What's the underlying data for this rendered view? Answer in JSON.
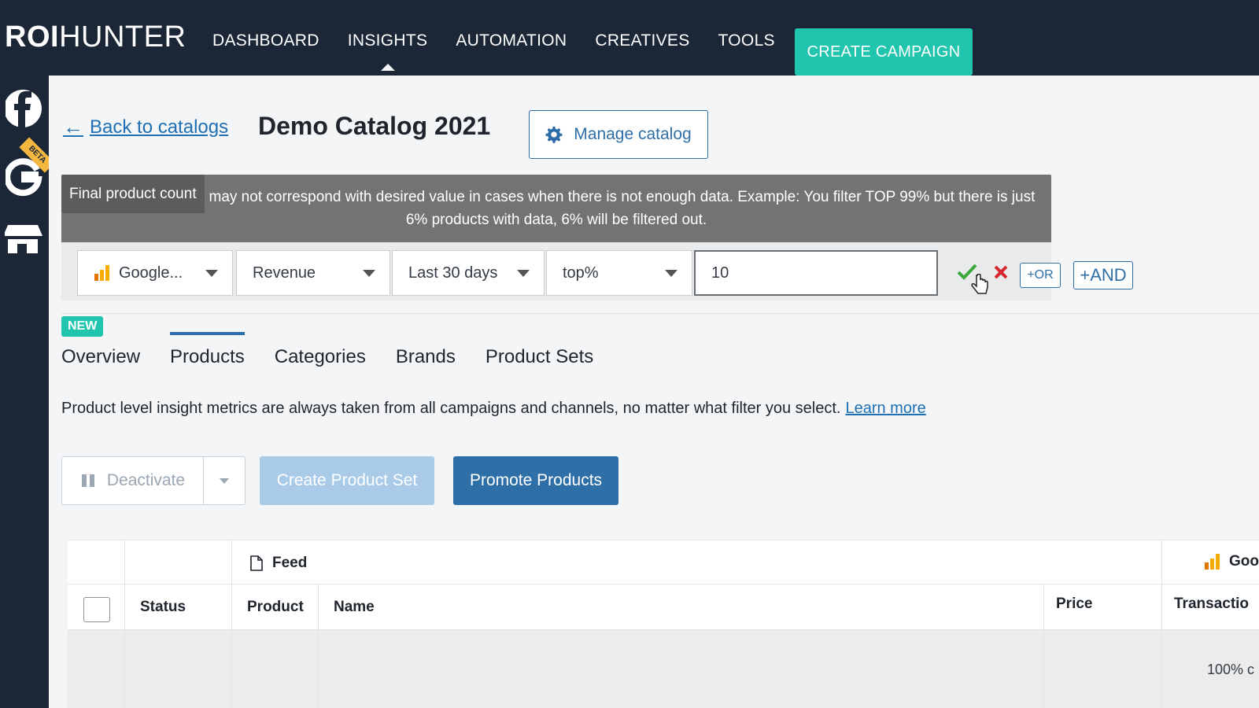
{
  "brand": {
    "logo_bold": "ROI",
    "logo_light": "HUNTER"
  },
  "nav": {
    "items": [
      {
        "label": "DASHBOARD"
      },
      {
        "label": "INSIGHTS",
        "active": true
      },
      {
        "label": "AUTOMATION"
      },
      {
        "label": "CREATIVES"
      },
      {
        "label": "TOOLS"
      }
    ],
    "create_campaign": "CREATE CAMPAIGN"
  },
  "rail": {
    "icons": [
      "facebook-icon",
      "google-icon",
      "shop-icon"
    ],
    "beta": "BETA"
  },
  "header": {
    "back_link": "Back to catalogs",
    "title": "Demo Catalog 2021",
    "manage_button": "Manage catalog"
  },
  "notice": {
    "text": "Final product count may not correspond with desired value in cases when there is not enough data. Example: You filter TOP 99% but there is just 6% products with data, 6% will be filtered out.",
    "tooltip": "Final product count"
  },
  "filter": {
    "source": "Google...",
    "metric": "Revenue",
    "period": "Last 30 days",
    "operator": "top%",
    "value": "10",
    "or_label": "+OR",
    "and_label": "+AND"
  },
  "tabs": {
    "new_badge": "NEW",
    "items": [
      {
        "label": "Overview"
      },
      {
        "label": "Products",
        "active": true
      },
      {
        "label": "Categories"
      },
      {
        "label": "Brands"
      },
      {
        "label": "Product Sets"
      }
    ]
  },
  "info": {
    "text": "Product level insight metrics are always taken from all campaigns and channels, no matter what filter you select.",
    "learn_more": "Learn more"
  },
  "actions": {
    "deactivate": "Deactivate",
    "create_product_set": "Create Product Set",
    "promote_products": "Promote Products"
  },
  "table": {
    "group_feed": "Feed",
    "group_google": "Goog",
    "columns": {
      "status": "Status",
      "product": "Product",
      "name": "Name",
      "price": "Price",
      "transactions": "Transactio"
    },
    "partial_value": "100% c"
  },
  "colors": {
    "nav_bg": "#1b2637",
    "accent": "#21c4ad",
    "primary": "#2f6fa8",
    "link": "#1e6fb3"
  }
}
